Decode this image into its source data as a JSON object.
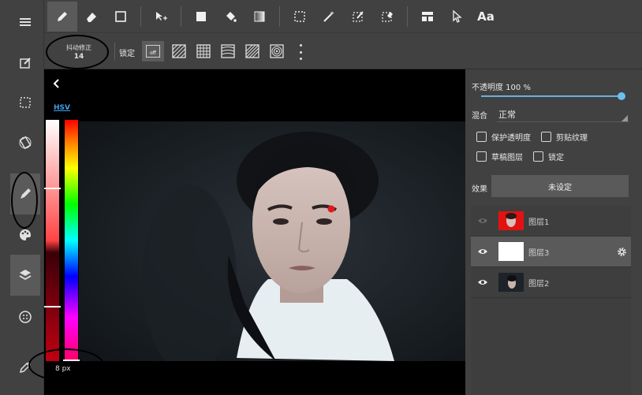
{
  "toolbar": {
    "tools": [
      "pen",
      "eraser",
      "rectangle-shape",
      "move-transform",
      "fill-rect",
      "bucket",
      "gradient",
      "rect-select",
      "magic-wand",
      "select-pen",
      "select-eraser",
      "layout",
      "pointer",
      "text"
    ],
    "text_tool_label": "Aa"
  },
  "subbar": {
    "stabilizer_label": "抖动修正",
    "stabilizer_value": "14",
    "lock_label": "锁定",
    "lock_off_label": "off"
  },
  "canvas": {
    "color_mode": "HSV",
    "brush_size": "8 px"
  },
  "layer_panel": {
    "opacity_label": "不透明度 100 %",
    "opacity": 1.0,
    "blend_label": "混合",
    "blend_value": "正常",
    "checkbox_protect": "保护透明度",
    "checkbox_clip": "剪贴纹理",
    "checkbox_draft": "草稿图层",
    "checkbox_lock": "锁定",
    "effect_label": "效果",
    "effect_value": "未设定",
    "layers": [
      {
        "name": "图层1",
        "visible": true,
        "thumb": "red-portrait"
      },
      {
        "name": "图层3",
        "visible": true,
        "thumb": "white"
      },
      {
        "name": "图层2",
        "visible": true,
        "thumb": "dark-portrait"
      }
    ]
  },
  "colors": {
    "accent": "#3fa0e8",
    "panel_bg": "#414141",
    "selected_bg": "#5a5a5a"
  }
}
